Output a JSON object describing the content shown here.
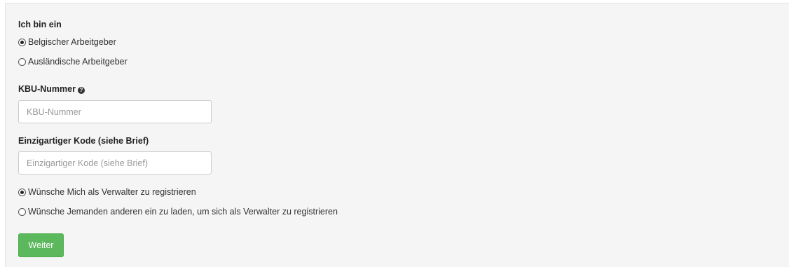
{
  "employer_type": {
    "label": "Ich bin ein",
    "options": [
      {
        "label": "Belgischer Arbeitgeber",
        "selected": true
      },
      {
        "label": "Ausländische Arbeitgeber",
        "selected": false
      }
    ]
  },
  "kbu": {
    "label": "KBU-Nummer",
    "help_icon": "question-circle-icon",
    "placeholder": "KBU-Nummer",
    "value": ""
  },
  "code": {
    "label": "Einzigartiger Kode (siehe Brief)",
    "placeholder": "Einzigartiger Kode (siehe Brief)",
    "value": ""
  },
  "registration": {
    "options": [
      {
        "label": "Wünsche Mich als Verwalter zu registrieren",
        "selected": true
      },
      {
        "label": "Wünsche Jemanden anderen ein zu laden, um sich als Verwalter zu registrieren",
        "selected": false
      }
    ]
  },
  "submit": {
    "label": "Weiter",
    "color": "#5cb85c"
  },
  "colors": {
    "panel_background": "#f5f5f5",
    "button_green": "#5cb85c"
  }
}
